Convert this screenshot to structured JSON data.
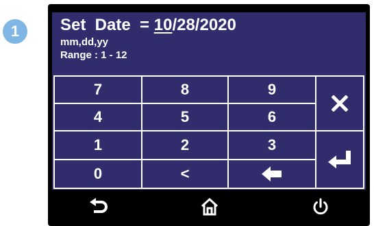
{
  "step_badge": "1",
  "header": {
    "label": "Set  Date  = ",
    "value_highlight": "10",
    "value_rest": "/28/2020",
    "format": "mm,dd,yy",
    "range": "Range :  1  -  12"
  },
  "keypad": {
    "keys": [
      {
        "label": "7",
        "name": "key-7"
      },
      {
        "label": "8",
        "name": "key-8"
      },
      {
        "label": "9",
        "name": "key-9"
      },
      {
        "label": "4",
        "name": "key-4"
      },
      {
        "label": "5",
        "name": "key-5"
      },
      {
        "label": "6",
        "name": "key-6"
      },
      {
        "label": "1",
        "name": "key-1"
      },
      {
        "label": "2",
        "name": "key-2"
      },
      {
        "label": "3",
        "name": "key-3"
      },
      {
        "label": "0",
        "name": "key-0"
      },
      {
        "label": "<",
        "name": "key-left"
      }
    ],
    "icons": {
      "backspace": "arrow-left-icon",
      "cancel": "close-icon",
      "enter": "enter-icon"
    }
  },
  "navbar": {
    "icons": [
      "back-icon",
      "home-icon",
      "power-icon"
    ]
  },
  "colors": {
    "screen": "#312d6c",
    "badge": "#7fb6e3",
    "device": "#000000"
  }
}
